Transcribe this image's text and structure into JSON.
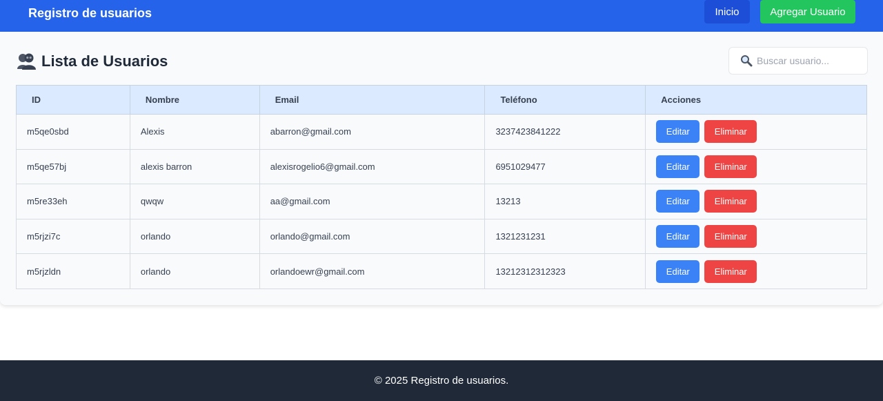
{
  "navbar": {
    "brand": "Registro de usuarios",
    "inicio_label": "Inicio",
    "agregar_label": "Agregar Usuario"
  },
  "main": {
    "title": "Lista de Usuarios",
    "search_placeholder": "Buscar usuario..."
  },
  "table": {
    "headers": [
      "ID",
      "Nombre",
      "Email",
      "Teléfono",
      "Acciones"
    ],
    "edit_label": "Editar",
    "delete_label": "Eliminar",
    "rows": [
      {
        "id": "m5qe0sbd",
        "nombre": "Alexis",
        "email": "abarron@gmail.com",
        "telefono": "3237423841222"
      },
      {
        "id": "m5qe57bj",
        "nombre": "alexis barron",
        "email": "alexisrogelio6@gmail.com",
        "telefono": "6951029477"
      },
      {
        "id": "m5re33eh",
        "nombre": "qwqw",
        "email": "aa@gmail.com",
        "telefono": "13213"
      },
      {
        "id": "m5rjzi7c",
        "nombre": "orlando",
        "email": "orlando@gmail.com",
        "telefono": "1321231231"
      },
      {
        "id": "m5rjzldn",
        "nombre": "orlando",
        "email": "orlandoewr@gmail.com",
        "telefono": "13212312312323"
      }
    ]
  },
  "footer": {
    "text": "© 2025 Registro de usuarios."
  },
  "colors": {
    "navbar": "#2563eb",
    "inicio": "#1d4ed8",
    "agregar": "#22c55e",
    "edit": "#3b82f6",
    "delete": "#ef4444",
    "table_header": "#dbeafe",
    "footer": "#1f2937"
  },
  "icons": {
    "title_icon": "users-icon",
    "search_icon": "search-icon"
  }
}
